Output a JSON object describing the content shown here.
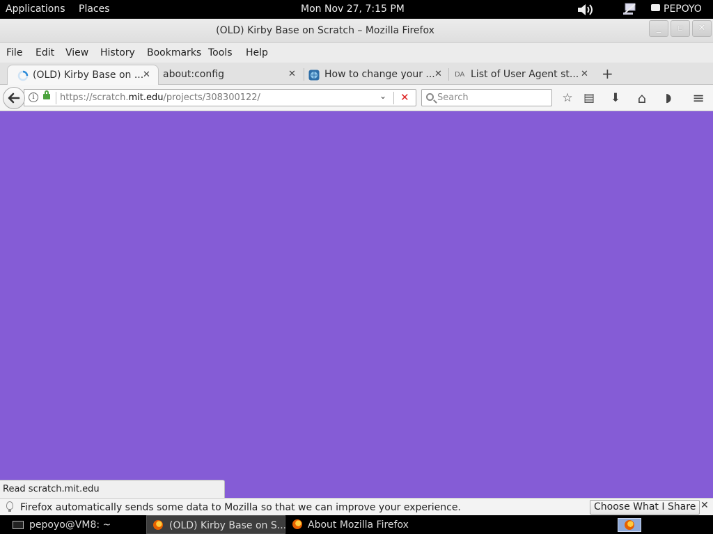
{
  "topbar": {
    "applications": "Applications",
    "places": "Places",
    "clock": "Mon Nov 27,  7:15 PM",
    "user": "PEPOYO"
  },
  "window": {
    "title": "(OLD) Kirby Base on Scratch – Mozilla Firefox",
    "minimize_glyph": "_",
    "maximize_glyph": "▫",
    "close_glyph": "✕"
  },
  "menubar": {
    "items": [
      "File",
      "Edit",
      "View",
      "History",
      "Bookmarks",
      "Tools",
      "Help"
    ]
  },
  "tabs": [
    {
      "label": "(OLD) Kirby Base on ...",
      "close": "✕",
      "active": true,
      "icon": "loading-spinner-icon"
    },
    {
      "label": "about:config",
      "close": "✕",
      "active": false
    },
    {
      "label": "How to change your ...",
      "close": "✕",
      "active": false,
      "icon": "globe-icon"
    },
    {
      "label": "List of User Agent st...",
      "close": "✕",
      "active": false,
      "icon": "da-favicon-icon",
      "icon_text": "DA"
    }
  ],
  "newtab": "+",
  "navbar": {
    "url_prefix": "https://scratch.",
    "url_host": "mit.edu",
    "url_path": "/projects/308300122/",
    "search_placeholder": "Search",
    "info_glyph": "i",
    "dropdown_glyph": "⌄",
    "stop_glyph": "✕",
    "bookmark_glyph": "☆",
    "library_glyph": "▤",
    "download_glyph": "⬇",
    "home_glyph": "⌂",
    "pocket_glyph": "◗",
    "menu_glyph": "≡"
  },
  "content": {
    "background": "#855cd6",
    "status": "Read scratch.mit.edu"
  },
  "notification": {
    "text": "Firefox automatically sends some data to Mozilla so that we can improve your experience.",
    "button": "Choose What I Share",
    "close": "✕"
  },
  "taskbar": {
    "items": [
      {
        "label": "pepoyo@VM8: ~"
      },
      {
        "label": "(OLD) Kirby Base on S..."
      },
      {
        "label": "About Mozilla Firefox"
      }
    ]
  }
}
